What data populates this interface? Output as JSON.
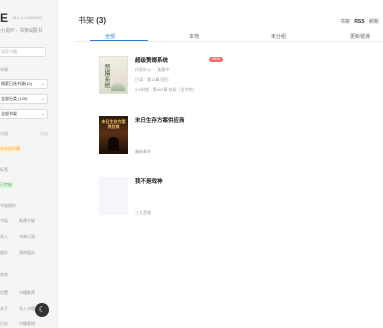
{
  "sidebar": {
    "brand_logo": "E",
    "version": "v3.2.14.0923080",
    "subtitle": "小说IP - 书架&翻书",
    "search_placeholder": "搜索书籍",
    "section1_label": "书源",
    "select1": "搜索已选书源(10)",
    "select2": "全部分类 (129)",
    "select3": "全部书架",
    "section2_label": "分组",
    "section2_action": "添加",
    "tag_orange": "未分组书籍",
    "section3_label": "标签",
    "tag_green": "已完结",
    "section4_label": "书架操作",
    "grid1": [
      "书架",
      "新建书架"
    ],
    "grid2": [
      "导入",
      "书源订阅"
    ],
    "grid3": [
      "缓存",
      "清除缓存"
    ],
    "section5_label": "其他",
    "grid4": [
      "设置",
      "书籍推荐"
    ],
    "grid5": [
      "关于",
      "导入书籍"
    ],
    "grid6": [
      "日志",
      "书籍管理"
    ],
    "theme_icon": "moon-icon"
  },
  "header": {
    "title_prefix": "书架",
    "count": "(3)",
    "links": [
      "书架",
      "RSS",
      "刷新"
    ]
  },
  "tabs": [
    "全部",
    "本地",
    "未分组",
    "更新错误"
  ],
  "books": [
    {
      "title": "超级赘婿系统",
      "badge": "NEW",
      "cover_text": "赘婿系统",
      "author": "作家叶公 ・ 连载中",
      "line2": "已读：第13章 回归",
      "line3": "3小时前 · 第802章 结局（全书完）"
    },
    {
      "title": "末日生存方案供应商",
      "cover_text": "末日生存方案供应商",
      "line1": "最新章节"
    },
    {
      "title": "我不是戏神",
      "line1": "三九音域"
    }
  ],
  "colors": {
    "accent": "#2a7fdb",
    "badge": "#f56c6c",
    "tag_orange": "#f5a623",
    "tag_green": "#4caf50"
  }
}
